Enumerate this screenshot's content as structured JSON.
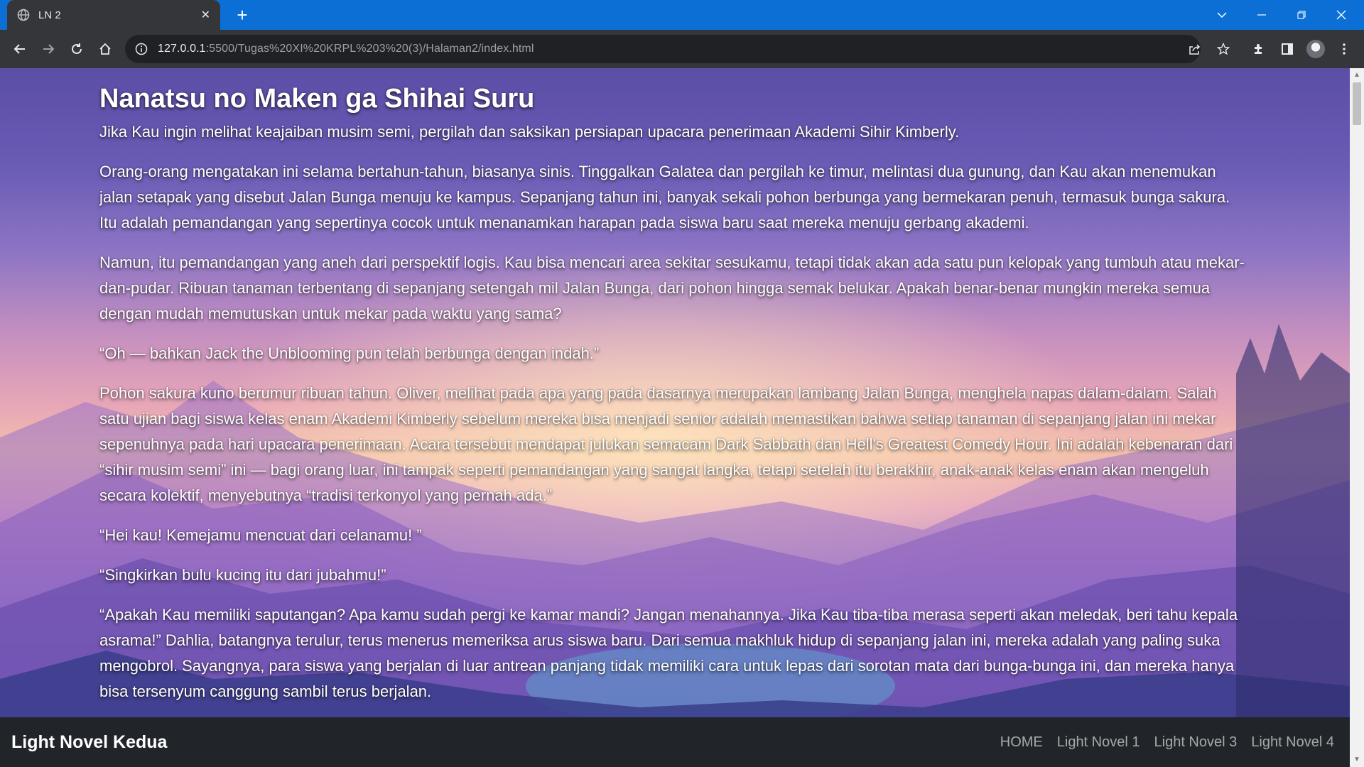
{
  "browser": {
    "tab_title": "LN 2",
    "url_host": "127.0.0.1",
    "url_rest": ":5500/Tugas%20XI%20KRPL%203%20(3)/Halaman2/index.html"
  },
  "colors": {
    "tabbar": "#0b6fd6",
    "toolbar": "#35363a",
    "navbar": "#212529",
    "text": "#ffffff"
  },
  "icons": [
    "globe-icon",
    "close-icon",
    "plus-icon",
    "chevron-down-icon",
    "minimize-icon",
    "restore-icon",
    "window-close-icon",
    "back-arrow-icon",
    "forward-arrow-icon",
    "reload-icon",
    "home-icon",
    "info-icon",
    "share-icon",
    "star-icon",
    "extensions-icon",
    "sidepanel-icon",
    "kebab-menu-icon"
  ],
  "article": {
    "title": "Nanatsu no Maken ga Shihai Suru",
    "paragraphs": [
      "Jika Kau ingin melihat keajaiban musim semi, pergilah dan saksikan persiapan upacara penerimaan Akademi Sihir Kimberly.",
      "Orang-orang mengatakan ini selama bertahun-tahun, biasanya sinis. Tinggalkan Galatea dan pergilah ke timur, melintasi dua gunung, dan Kau akan menemukan jalan setapak yang disebut Jalan Bunga menuju ke kampus. Sepanjang tahun ini, banyak sekali pohon berbunga yang bermekaran penuh, termasuk bunga sakura. Itu adalah pemandangan yang sepertinya cocok untuk menanamkan harapan pada siswa baru saat mereka menuju gerbang akademi.",
      "Namun, itu pemandangan yang aneh dari perspektif logis. Kau bisa mencari area sekitar sesukamu, tetapi tidak akan ada satu pun kelopak yang tumbuh atau mekar-dan-pudar. Ribuan tanaman terbentang di sepanjang setengah mil Jalan Bunga, dari pohon hingga semak belukar. Apakah benar-benar mungkin mereka semua dengan mudah memutuskan untuk mekar pada waktu yang sama?",
      "“Oh — bahkan Jack the Unblooming pun telah berbunga dengan indah.”",
      "Pohon sakura kuno berumur ribuan tahun. Oliver, melihat pada apa yang pada dasarnya merupakan lambang Jalan Bunga, menghela napas dalam-dalam. Salah satu ujian bagi siswa kelas enam Akademi Kimberly sebelum mereka bisa menjadi senior adalah memastikan bahwa setiap tanaman di sepanjang jalan ini mekar sepenuhnya pada hari upacara penerimaan. Acara tersebut mendapat julukan semacam Dark Sabbath dan Hell's Greatest Comedy Hour. Ini adalah kebenaran dari “sihir musim semi” ini — bagi orang luar, ini tampak seperti pemandangan yang sangat langka, tetapi setelah itu berakhir, anak-anak kelas enam akan mengeluh secara kolektif, menyebutnya “tradisi terkonyol yang pernah ada.”",
      "“Hei kau! Kemejamu mencuat dari celanamu! ”",
      "“Singkirkan bulu kucing itu dari jubahmu!”",
      "“Apakah Kau memiliki saputangan? Apa kamu sudah pergi ke kamar mandi? Jangan menahannya. Jika Kau tiba-tiba merasa seperti akan meledak, beri tahu kepala asrama!” Dahlia, batangnya terulur, terus menerus memeriksa arus siswa baru. Dari semua makhluk hidup di sepanjang jalan ini, mereka adalah yang paling suka mengobrol. Sayangnya, para siswa yang berjalan di luar antrean panjang tidak memiliki cara untuk lepas dari sorotan mata dari bunga-bunga ini, dan mereka hanya bisa tersenyum canggung sambil terus berjalan."
    ]
  },
  "navbar": {
    "brand": "Light Novel Kedua",
    "links": [
      "HOME",
      "Light Novel 1",
      "Light Novel 3",
      "Light Novel 4"
    ]
  }
}
